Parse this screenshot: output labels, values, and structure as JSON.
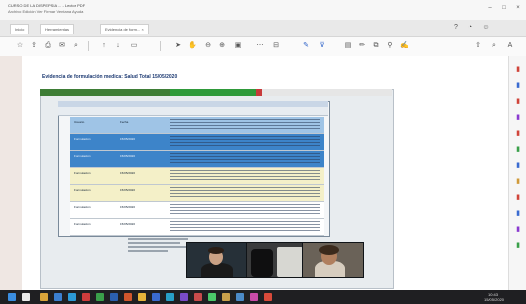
{
  "window": {
    "title": "CURSO DE LA DISPEPSIA ... - Lector PDF",
    "menu": "Archivo  Edición  Ver  Firmar  Ventana  Ayuda",
    "controls": [
      "minimize-icon",
      "maximize-icon",
      "close-icon"
    ]
  },
  "tabs": [
    {
      "label": "Inicio"
    },
    {
      "label": "Herramientas"
    },
    {
      "label": "Evidencia de form... ×"
    }
  ],
  "toolbar": {
    "icons": [
      "save-icon",
      "print-icon",
      "email-icon",
      "search-icon",
      "prev-page-icon",
      "next-page-icon",
      "pointer-icon",
      "hand-icon",
      "zoom-out-icon",
      "zoom-in-icon",
      "zoom-level-icon",
      "annotate-icon",
      "highlight-icon",
      "draw-icon",
      "sign-icon",
      "share-icon"
    ]
  },
  "document": {
    "title": "Evidencia de formulación medica: Salud Total 15/05/2020"
  },
  "records": [
    {
      "style": "lightblue",
      "c1": "Usuario",
      "c2": "Fecha",
      "c3": ""
    },
    {
      "style": "blue",
      "c1": "Formulación",
      "c2": "15/05/2020",
      "c3": ""
    },
    {
      "style": "blue",
      "c1": "Formulación",
      "c2": "15/05/2020",
      "c3": ""
    },
    {
      "style": "cream",
      "c1": "Formulación",
      "c2": "15/05/2020",
      "c3": ""
    },
    {
      "style": "cream",
      "c1": "Formulación",
      "c2": "15/05/2020",
      "c3": ""
    },
    {
      "style": "white",
      "c1": "Formulación",
      "c2": "15/05/2020",
      "c3": ""
    },
    {
      "style": "white",
      "c1": "Formulación",
      "c2": "15/05/2020",
      "c3": ""
    }
  ],
  "participants": [
    {
      "name": "participant-1"
    },
    {
      "name": "participant-2"
    },
    {
      "name": "participant-3"
    }
  ],
  "taskbar": {
    "clock_time": "10:43",
    "clock_date": "15/05/2020"
  },
  "colors": {
    "accent": "#2a60c8",
    "slide_header": "#3e7d36",
    "row_blue": "#3d84c9",
    "row_cream": "#f4f0c8"
  }
}
